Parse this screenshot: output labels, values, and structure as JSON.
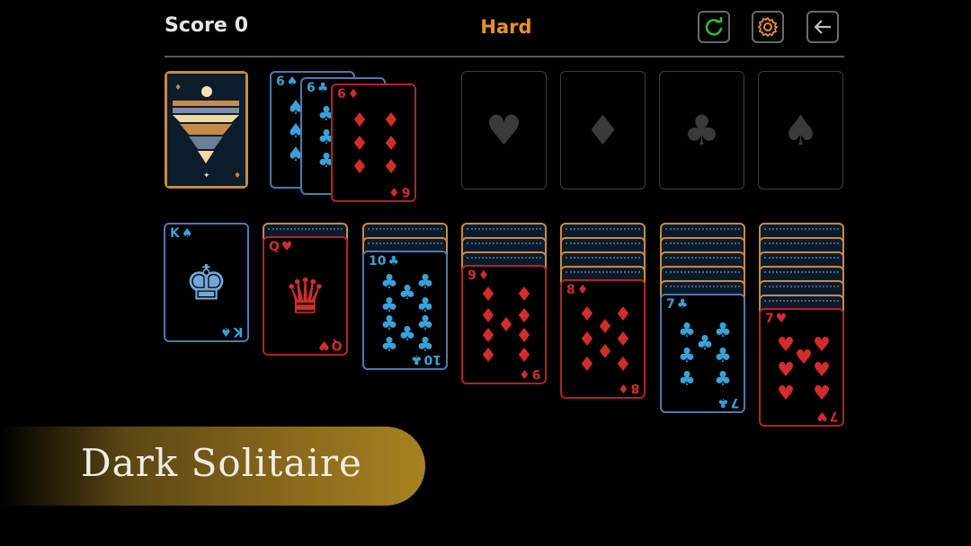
{
  "header": {
    "score_label": "Score",
    "score_value": "0",
    "difficulty": "Hard",
    "difficulty_color": "#e8922c",
    "icons": [
      "restart-icon",
      "settings-icon",
      "back-arrow-icon"
    ]
  },
  "colors": {
    "red": "#d22c2c",
    "blue": "#4a7bb0",
    "club_blue": "#3aa1d8",
    "card_back_border": "#c98a43"
  },
  "stock": {
    "state": "face-down"
  },
  "waste": [
    {
      "rank": "6",
      "suit": "♠"
    },
    {
      "rank": "6",
      "suit": "♣"
    },
    {
      "rank": "6",
      "suit": "♦"
    }
  ],
  "foundations": [
    "♥",
    "♦",
    "♣",
    "♠"
  ],
  "tableau": [
    {
      "hidden": 0,
      "rank": "K",
      "suit": "♠"
    },
    {
      "hidden": 1,
      "rank": "Q",
      "suit": "♥"
    },
    {
      "hidden": 2,
      "rank": "10",
      "suit": "♣"
    },
    {
      "hidden": 3,
      "rank": "9",
      "suit": "♦"
    },
    {
      "hidden": 4,
      "rank": "8",
      "suit": "♦"
    },
    {
      "hidden": 5,
      "rank": "7",
      "suit": "♣"
    },
    {
      "hidden": 6,
      "rank": "7",
      "suit": "♥"
    }
  ],
  "banner": {
    "title": "Dark Solitaire"
  }
}
